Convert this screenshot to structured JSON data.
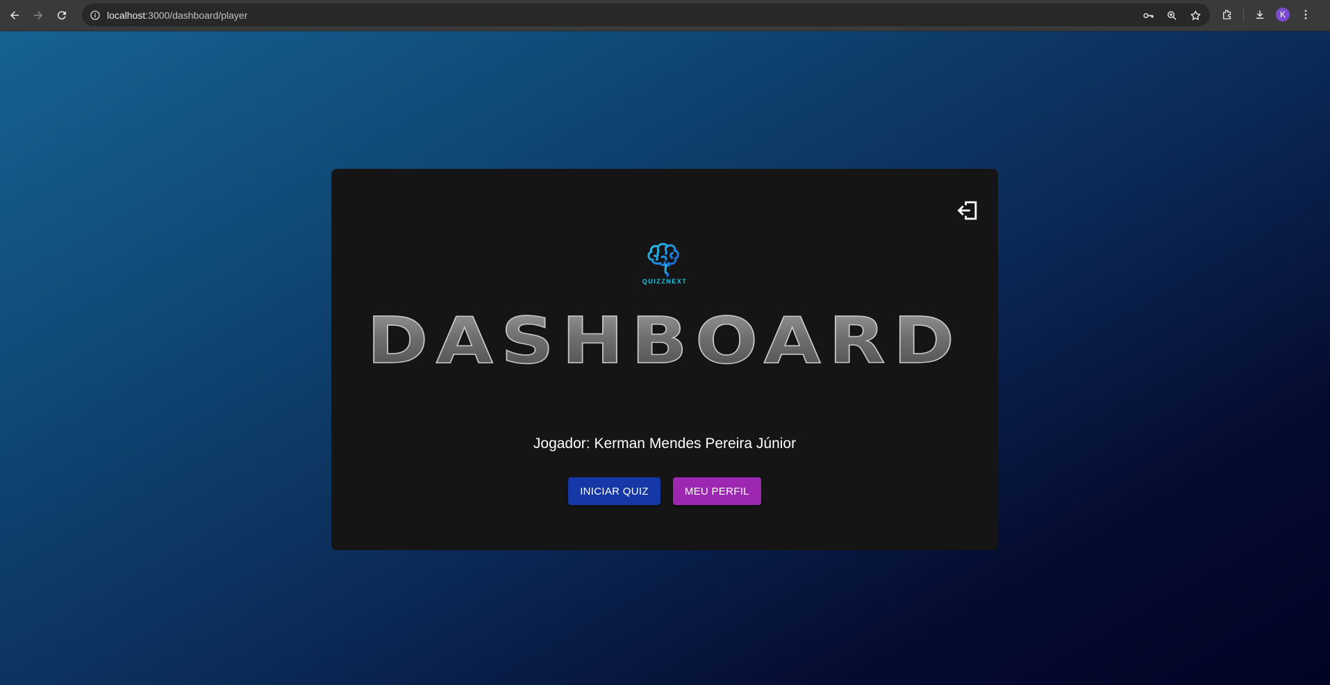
{
  "browser": {
    "url_host": "localhost",
    "url_path": ":3000/dashboard/player",
    "profile_initial": "K"
  },
  "card": {
    "logo_text": "QUIZZNEXT",
    "title": "DASHBOARD",
    "player_label": "Jogador: Kerman Mendes Pereira Júnior",
    "buttons": {
      "start_quiz": "INICIAR QUIZ",
      "my_profile": "MEU PERFIL"
    }
  },
  "colors": {
    "primary_button": "#1637a6",
    "secondary_button": "#9c27b0",
    "logo_accent": "#22c3dc",
    "card_bg": "#151515"
  },
  "icons": {
    "logout": "logout-icon",
    "brain_logo": "brain-logo-icon"
  }
}
